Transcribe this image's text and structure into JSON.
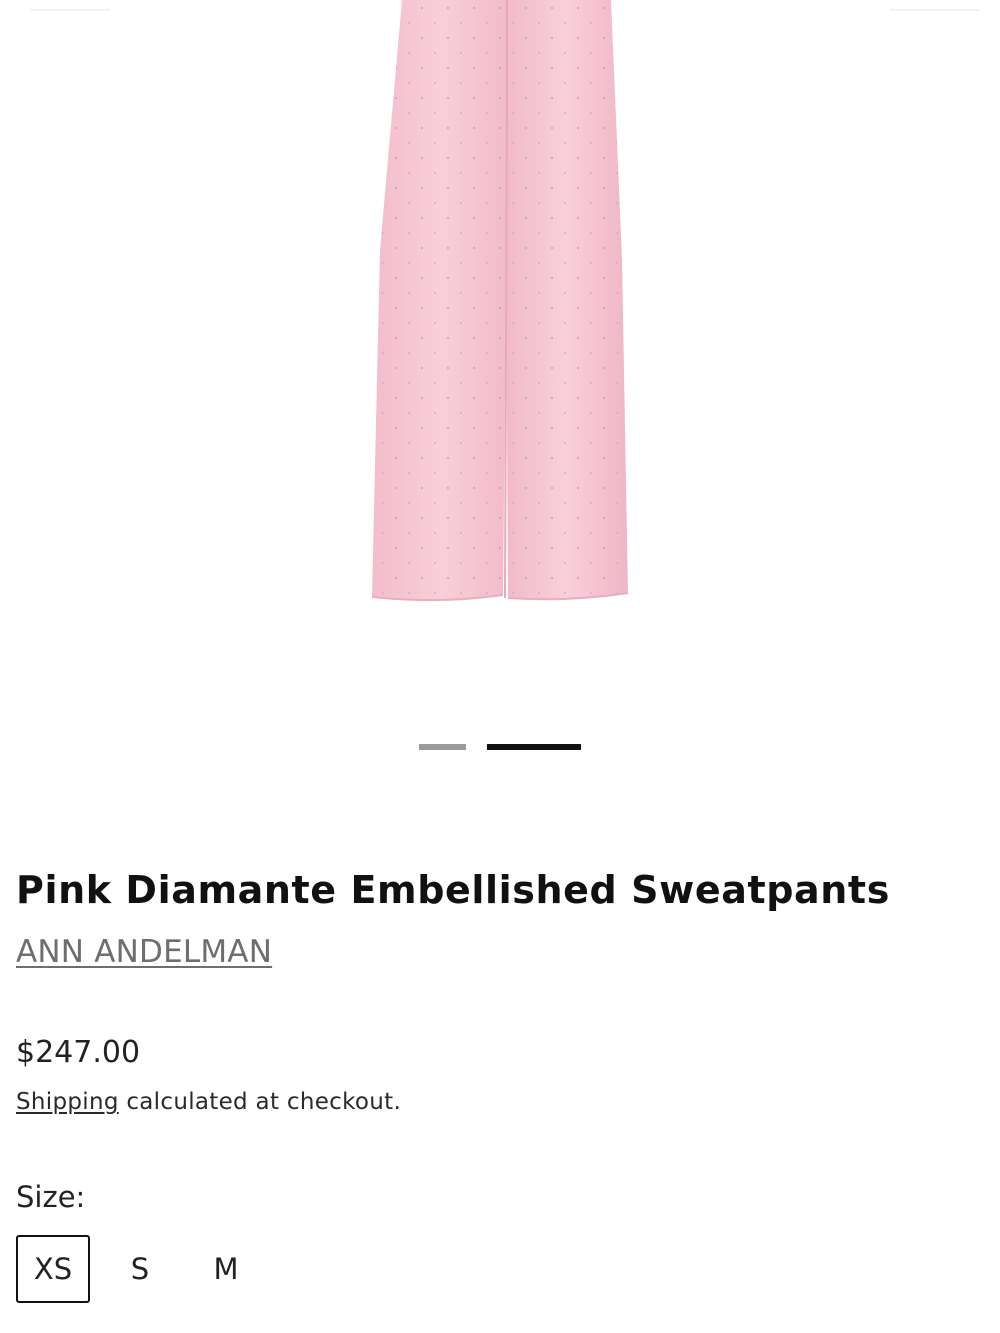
{
  "gallery": {
    "image_subject": "pink wide-leg sweatpants with diamante embellishment",
    "product_color": "#f6c6d2",
    "slides": [
      {
        "active": false
      },
      {
        "active": true
      }
    ]
  },
  "product": {
    "title": "Pink Diamante Embellished Sweatpants",
    "vendor": "ANN ANDELMAN",
    "price": "$247.00",
    "shipping_link": "Shipping",
    "shipping_rest": " calculated at checkout."
  },
  "variants": {
    "size_label": "Size:",
    "sizes": [
      "XS",
      "S",
      "M"
    ],
    "selected": "XS"
  }
}
